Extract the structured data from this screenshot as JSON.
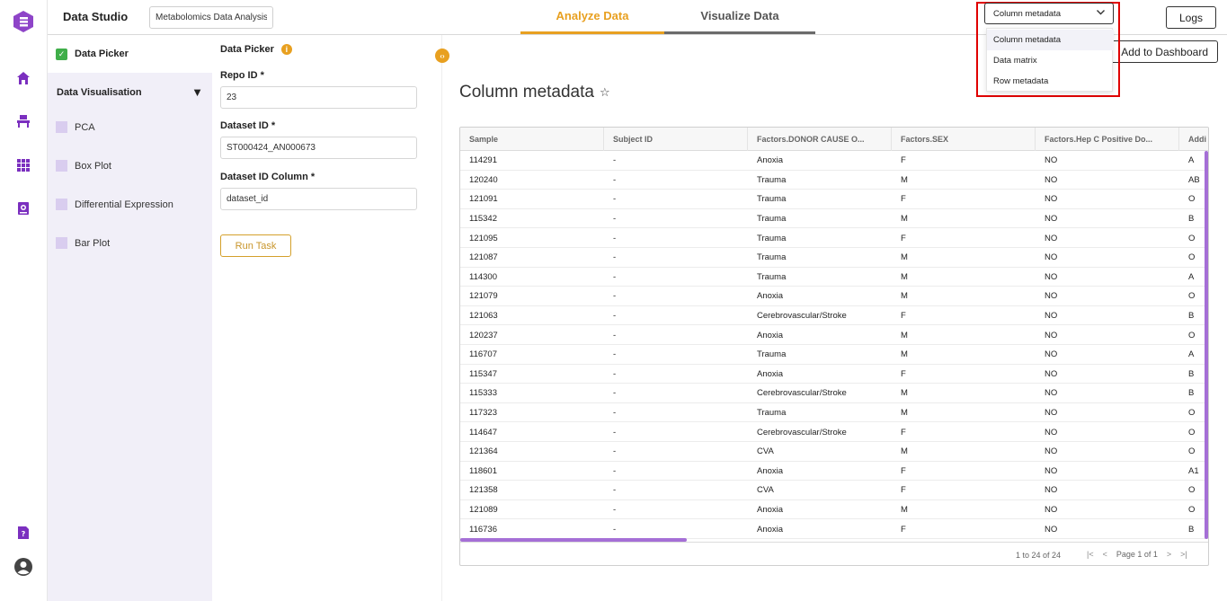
{
  "app": {
    "title": "Data Studio",
    "project_name": "Metabolomics Data Analysis"
  },
  "tabs": [
    {
      "label": "Analyze Data",
      "active": true
    },
    {
      "label": "Visualize Data",
      "active": false
    }
  ],
  "header": {
    "logs_label": "Logs",
    "dataset_select": {
      "selected": "Column metadata",
      "options": [
        "Column metadata",
        "Data matrix",
        "Row metadata"
      ]
    }
  },
  "sidebar": {
    "picker_label": "Data Picker",
    "section_label": "Data Visualisation",
    "section_toggle": "▼",
    "items": [
      {
        "label": "PCA"
      },
      {
        "label": "Box Plot"
      },
      {
        "label": "Differential Expression"
      },
      {
        "label": "Bar Plot"
      }
    ]
  },
  "picker": {
    "title": "Data Picker",
    "info_glyph": "i",
    "repo_label": "Repo ID *",
    "repo_value": "23",
    "dataset_label": "Dataset ID *",
    "dataset_value": "ST000424_AN000673",
    "column_label": "Dataset ID Column *",
    "column_value": "dataset_id",
    "run_label": "Run Task"
  },
  "main": {
    "title": "Column metadata",
    "star_glyph": "☆",
    "add_dashboard_label": "Add to Dashboard"
  },
  "table": {
    "columns": [
      "Sample",
      "Subject ID",
      "Factors.DONOR CAUSE O...",
      "Factors.SEX",
      "Factors.Hep C Positive Do...",
      "Addi"
    ],
    "rows": [
      [
        "114291",
        "-",
        "Anoxia",
        "F",
        "NO",
        "A"
      ],
      [
        "120240",
        "-",
        "Trauma",
        "M",
        "NO",
        "AB"
      ],
      [
        "121091",
        "-",
        "Trauma",
        "F",
        "NO",
        "O"
      ],
      [
        "115342",
        "-",
        "Trauma",
        "M",
        "NO",
        "B"
      ],
      [
        "121095",
        "-",
        "Trauma",
        "F",
        "NO",
        "O"
      ],
      [
        "121087",
        "-",
        "Trauma",
        "M",
        "NO",
        "O"
      ],
      [
        "114300",
        "-",
        "Trauma",
        "M",
        "NO",
        "A"
      ],
      [
        "121079",
        "-",
        "Anoxia",
        "M",
        "NO",
        "O"
      ],
      [
        "121063",
        "-",
        "Cerebrovascular/Stroke",
        "F",
        "NO",
        "B"
      ],
      [
        "120237",
        "-",
        "Anoxia",
        "M",
        "NO",
        "O"
      ],
      [
        "116707",
        "-",
        "Trauma",
        "M",
        "NO",
        "A"
      ],
      [
        "115347",
        "-",
        "Anoxia",
        "F",
        "NO",
        "B"
      ],
      [
        "115333",
        "-",
        "Cerebrovascular/Stroke",
        "M",
        "NO",
        "B"
      ],
      [
        "117323",
        "-",
        "Trauma",
        "M",
        "NO",
        "O"
      ],
      [
        "114647",
        "-",
        "Cerebrovascular/Stroke",
        "F",
        "NO",
        "O"
      ],
      [
        "121364",
        "-",
        "CVA",
        "M",
        "NO",
        "O"
      ],
      [
        "118601",
        "-",
        "Anoxia",
        "F",
        "NO",
        "A1"
      ],
      [
        "121358",
        "-",
        "CVA",
        "F",
        "NO",
        "O"
      ],
      [
        "121089",
        "-",
        "Anoxia",
        "M",
        "NO",
        "O"
      ],
      [
        "116736",
        "-",
        "Anoxia",
        "F",
        "NO",
        "B"
      ]
    ],
    "footer_count": "1 to 24 of 24",
    "page_label": "Page 1 of 1",
    "pager_first": "|<",
    "pager_prev": "<",
    "pager_next": ">",
    "pager_last": ">|"
  },
  "colors": {
    "accent": "#e8a020",
    "brand": "#8e44c8",
    "scroll": "#a56fd6",
    "highlight_frame": "#e00000"
  }
}
